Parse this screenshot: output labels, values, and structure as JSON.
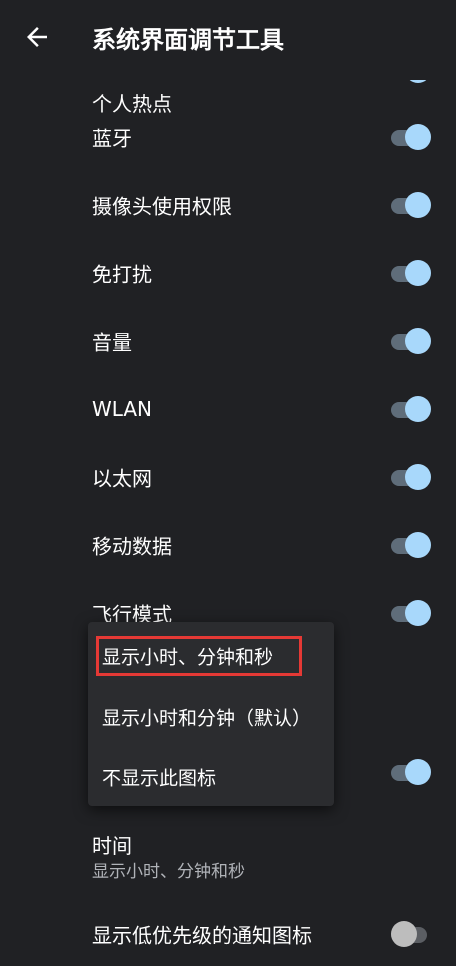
{
  "header": {
    "title": "系统界面调节工具"
  },
  "rows": [
    {
      "label": "个人热点",
      "on": true
    },
    {
      "label": "蓝牙",
      "on": true
    },
    {
      "label": "摄像头使用权限",
      "on": true
    },
    {
      "label": "免打扰",
      "on": true
    },
    {
      "label": "音量",
      "on": true
    },
    {
      "label": "WLAN",
      "on": true
    },
    {
      "label": "以太网",
      "on": true
    },
    {
      "label": "移动数据",
      "on": true
    },
    {
      "label": "飞行模式",
      "on": true
    },
    {
      "label": "",
      "on": true
    },
    {
      "label": "显示低优先级的通知图标",
      "on": false
    }
  ],
  "time": {
    "title": "时间",
    "summary": "显示小时、分钟和秒"
  },
  "menu": {
    "options": [
      "显示小时、分钟和秒",
      "显示小时和分钟（默认）",
      "不显示此图标"
    ],
    "selected_index": 0
  },
  "colors": {
    "background": "#202124",
    "toggle_on": "#a8d8fb",
    "highlight": "#e53935"
  }
}
